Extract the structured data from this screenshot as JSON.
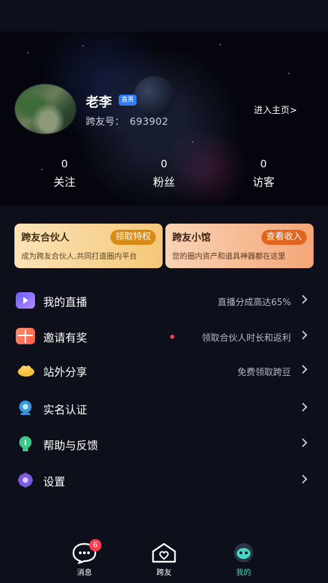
{
  "profile": {
    "name": "老李",
    "badge": "直男",
    "id_label": "跨友号：",
    "id_value": "693902",
    "home_link": "进入主页>"
  },
  "stats": [
    {
      "value": "0",
      "label": "关注"
    },
    {
      "value": "0",
      "label": "粉丝"
    },
    {
      "value": "0",
      "label": "访客"
    }
  ],
  "cards": [
    {
      "title": "跨友合伙人",
      "action": "领取特权",
      "desc": "成为跨友合伙人,共同打造圈内平台"
    },
    {
      "title": "跨友小馆",
      "action": "查看收入",
      "desc": "您的圈内资产和道具神器都在这里"
    }
  ],
  "menu": [
    {
      "icon": "live-camera-icon",
      "label": "我的直播",
      "hint": "直播分成高达65%"
    },
    {
      "icon": "gift-box-icon",
      "label": "邀请有奖",
      "hint": "领取合伙人时长和返利"
    },
    {
      "icon": "cloud-share-icon",
      "label": "站外分享",
      "hint": "免费领取跨豆"
    },
    {
      "icon": "id-verify-icon",
      "label": "实名认证",
      "hint": ""
    },
    {
      "icon": "help-bulb-icon",
      "label": "帮助与反馈",
      "hint": ""
    },
    {
      "icon": "settings-gear-icon",
      "label": "设置",
      "hint": ""
    }
  ],
  "tabs": [
    {
      "icon": "message-bubble-icon",
      "label": "消息",
      "badge": "6"
    },
    {
      "icon": "heart-home-icon",
      "label": "跨友"
    },
    {
      "icon": "robot-avatar-icon",
      "label": "我的"
    }
  ],
  "colors": {
    "accent": "#46d6c4",
    "badge_red": "#ff3b4f",
    "vip_blue": "#2f7cf6"
  }
}
